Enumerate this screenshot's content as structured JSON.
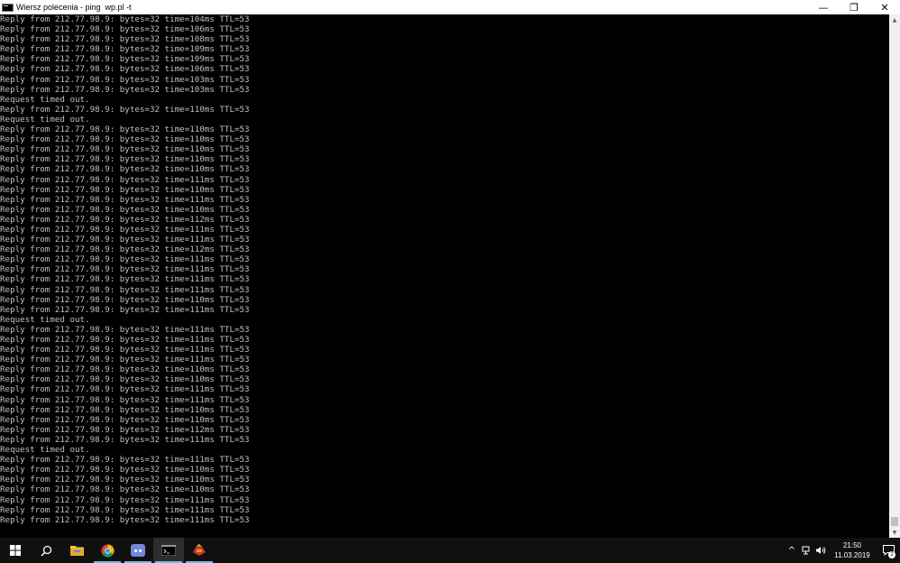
{
  "window": {
    "title": "Wiersz polecenia - ping  wp.pl -t",
    "minimize": "—",
    "restore": "❐",
    "close": "✕"
  },
  "console": {
    "lines": [
      "Reply from 212.77.98.9: bytes=32 time=104ms TTL=53",
      "Reply from 212.77.98.9: bytes=32 time=106ms TTL=53",
      "Reply from 212.77.98.9: bytes=32 time=108ms TTL=53",
      "Reply from 212.77.98.9: bytes=32 time=109ms TTL=53",
      "Reply from 212.77.98.9: bytes=32 time=109ms TTL=53",
      "Reply from 212.77.98.9: bytes=32 time=106ms TTL=53",
      "Reply from 212.77.98.9: bytes=32 time=103ms TTL=53",
      "Reply from 212.77.98.9: bytes=32 time=103ms TTL=53",
      "Request timed out.",
      "Reply from 212.77.98.9: bytes=32 time=110ms TTL=53",
      "Request timed out.",
      "Reply from 212.77.98.9: bytes=32 time=110ms TTL=53",
      "Reply from 212.77.98.9: bytes=32 time=110ms TTL=53",
      "Reply from 212.77.98.9: bytes=32 time=110ms TTL=53",
      "Reply from 212.77.98.9: bytes=32 time=110ms TTL=53",
      "Reply from 212.77.98.9: bytes=32 time=110ms TTL=53",
      "Reply from 212.77.98.9: bytes=32 time=111ms TTL=53",
      "Reply from 212.77.98.9: bytes=32 time=110ms TTL=53",
      "Reply from 212.77.98.9: bytes=32 time=111ms TTL=53",
      "Reply from 212.77.98.9: bytes=32 time=110ms TTL=53",
      "Reply from 212.77.98.9: bytes=32 time=112ms TTL=53",
      "Reply from 212.77.98.9: bytes=32 time=111ms TTL=53",
      "Reply from 212.77.98.9: bytes=32 time=111ms TTL=53",
      "Reply from 212.77.98.9: bytes=32 time=112ms TTL=53",
      "Reply from 212.77.98.9: bytes=32 time=111ms TTL=53",
      "Reply from 212.77.98.9: bytes=32 time=111ms TTL=53",
      "Reply from 212.77.98.9: bytes=32 time=111ms TTL=53",
      "Reply from 212.77.98.9: bytes=32 time=111ms TTL=53",
      "Reply from 212.77.98.9: bytes=32 time=110ms TTL=53",
      "Reply from 212.77.98.9: bytes=32 time=111ms TTL=53",
      "Request timed out.",
      "Reply from 212.77.98.9: bytes=32 time=111ms TTL=53",
      "Reply from 212.77.98.9: bytes=32 time=111ms TTL=53",
      "Reply from 212.77.98.9: bytes=32 time=111ms TTL=53",
      "Reply from 212.77.98.9: bytes=32 time=111ms TTL=53",
      "Reply from 212.77.98.9: bytes=32 time=110ms TTL=53",
      "Reply from 212.77.98.9: bytes=32 time=110ms TTL=53",
      "Reply from 212.77.98.9: bytes=32 time=111ms TTL=53",
      "Reply from 212.77.98.9: bytes=32 time=111ms TTL=53",
      "Reply from 212.77.98.9: bytes=32 time=110ms TTL=53",
      "Reply from 212.77.98.9: bytes=32 time=110ms TTL=53",
      "Reply from 212.77.98.9: bytes=32 time=112ms TTL=53",
      "Reply from 212.77.98.9: bytes=32 time=111ms TTL=53",
      "Request timed out.",
      "Reply from 212.77.98.9: bytes=32 time=111ms TTL=53",
      "Reply from 212.77.98.9: bytes=32 time=110ms TTL=53",
      "Reply from 212.77.98.9: bytes=32 time=110ms TTL=53",
      "Reply from 212.77.98.9: bytes=32 time=110ms TTL=53",
      "Reply from 212.77.98.9: bytes=32 time=111ms TTL=53",
      "Reply from 212.77.98.9: bytes=32 time=111ms TTL=53",
      "Reply from 212.77.98.9: bytes=32 time=111ms TTL=53"
    ],
    "text_color": "#c0c0c0",
    "background": "#000000"
  },
  "scrollbar": {
    "up_arrow": "▲",
    "down_arrow": "▼"
  },
  "taskbar": {
    "apps": [
      {
        "name": "start",
        "icon": "windows-logo-icon"
      },
      {
        "name": "search",
        "icon": "search-icon"
      },
      {
        "name": "file-explorer",
        "icon": "folder-icon"
      },
      {
        "name": "chrome",
        "icon": "chrome-icon"
      },
      {
        "name": "discord",
        "icon": "discord-icon"
      },
      {
        "name": "command-prompt",
        "icon": "terminal-icon"
      },
      {
        "name": "game",
        "icon": "game-icon"
      }
    ],
    "tray": {
      "chevron": "^",
      "network_icon": "network-icon",
      "volume_icon": "volume-icon",
      "time": "21:50",
      "date": "11.03.2019",
      "notifications_count": "2"
    }
  },
  "colors": {
    "taskbar": "#101010",
    "accent": "#76b9ed"
  }
}
